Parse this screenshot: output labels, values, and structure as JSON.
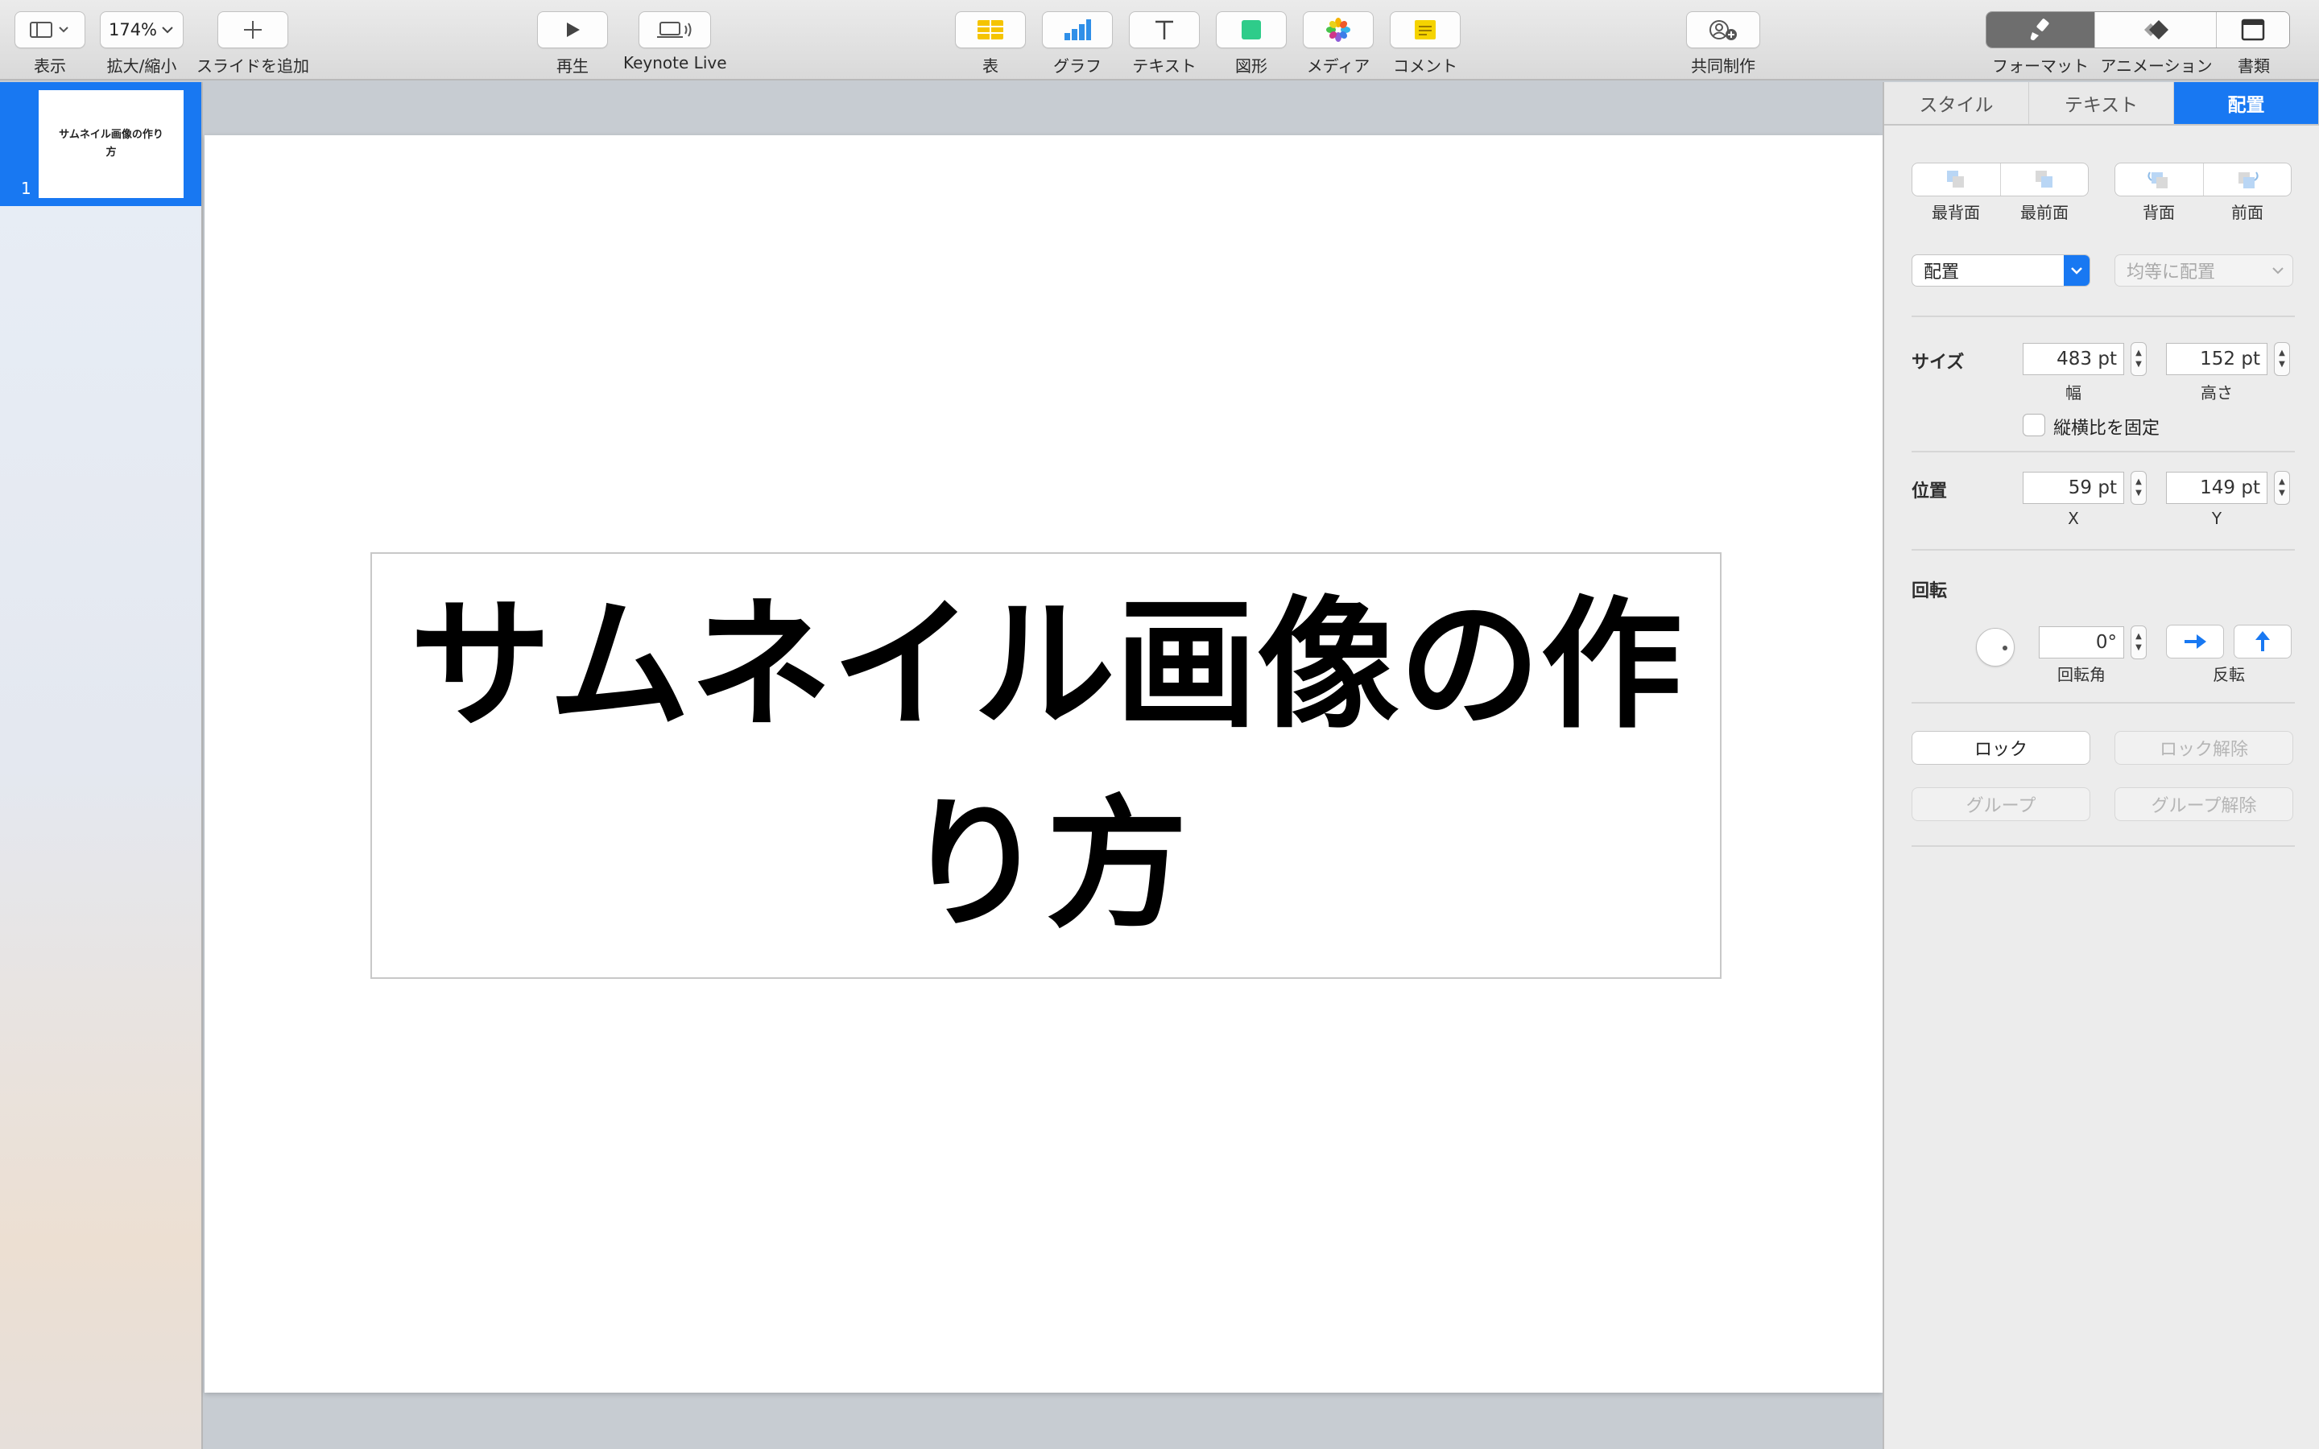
{
  "toolbar": {
    "view": {
      "label": "表示"
    },
    "zoom": {
      "value": "174%",
      "label": "拡大/縮小"
    },
    "add_slide": {
      "label": "スライドを追加"
    },
    "play": {
      "label": "再生"
    },
    "keynote_live": {
      "label": "Keynote Live"
    },
    "table": {
      "label": "表"
    },
    "chart": {
      "label": "グラフ"
    },
    "text": {
      "label": "テキスト"
    },
    "shape": {
      "label": "図形"
    },
    "media": {
      "label": "メディア"
    },
    "comment": {
      "label": "コメント"
    },
    "collaborate": {
      "label": "共同制作"
    },
    "format": {
      "label": "フォーマット"
    },
    "animate": {
      "label": "アニメーション"
    },
    "document": {
      "label": "書類"
    }
  },
  "sidebar": {
    "slides": [
      {
        "number": "1",
        "title": "サムネイル画像の作り方"
      }
    ]
  },
  "slide": {
    "title": "サムネイル画像の作り方"
  },
  "inspector": {
    "tabs": [
      {
        "label": "スタイル"
      },
      {
        "label": "テキスト"
      },
      {
        "label": "配置"
      }
    ],
    "arrange": {
      "back": "最背面",
      "front": "最前面",
      "backward": "背面",
      "forward": "前面"
    },
    "align_dropdown": "配置",
    "distribute_dropdown": "均等に配置",
    "size": {
      "title": "サイズ",
      "width": "483 pt",
      "width_label": "幅",
      "height": "152 pt",
      "height_label": "高さ",
      "constrain": "縦横比を固定"
    },
    "position": {
      "title": "位置",
      "x": "59 pt",
      "x_label": "X",
      "y": "149 pt",
      "y_label": "Y"
    },
    "rotate": {
      "title": "回転",
      "angle": "0°",
      "angle_label": "回転角",
      "flip_label": "反転"
    },
    "lock": "ロック",
    "unlock": "ロック解除",
    "group": "グループ",
    "ungroup": "グループ解除"
  },
  "colors": {
    "accent": "#1878f2",
    "table_icon": "#f5c400",
    "shape_icon": "#2ecc8a",
    "comment_icon": "#f5d300"
  }
}
